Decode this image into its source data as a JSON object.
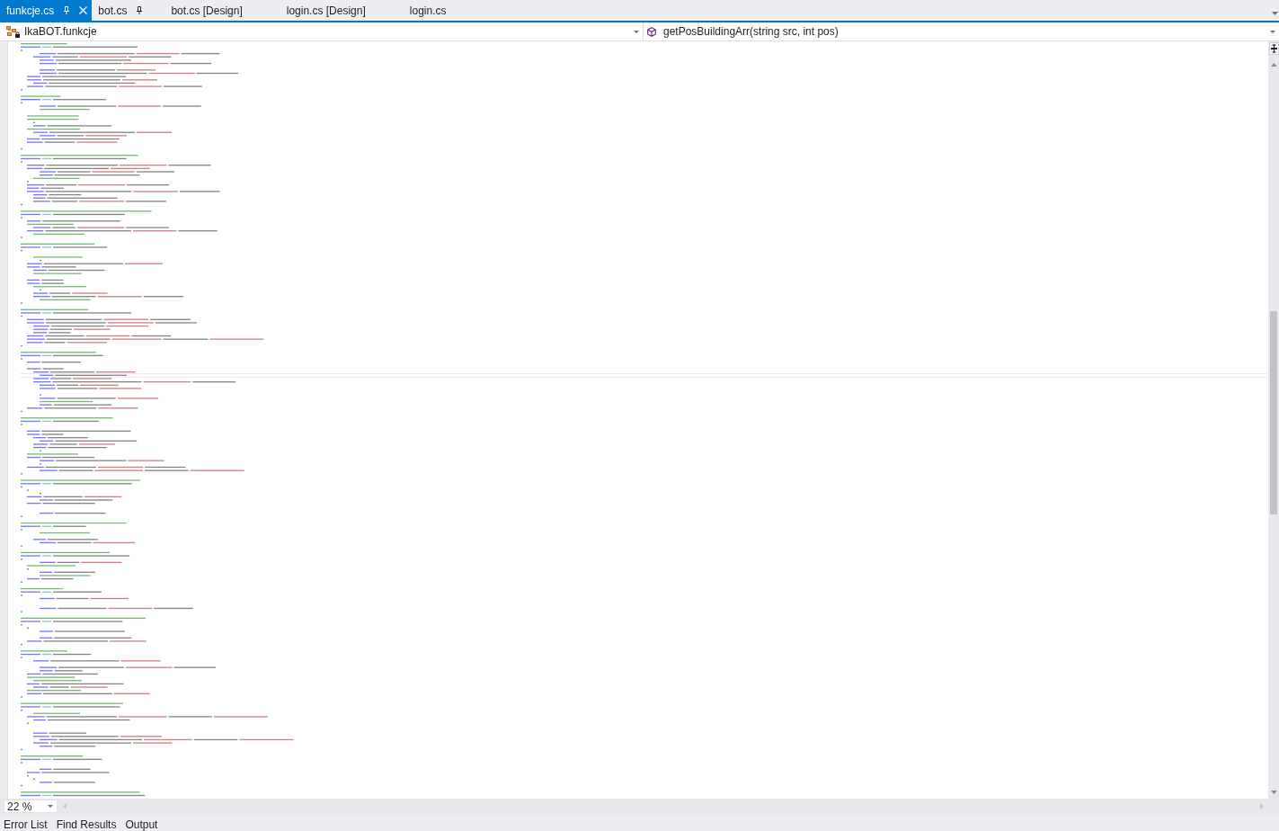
{
  "document_tabs": [
    {
      "label": "funkcje.cs",
      "selected": true,
      "pinned": true
    },
    {
      "label": "bot.cs",
      "selected": false,
      "pinned": true
    },
    {
      "label": "bot.cs [Design]",
      "selected": false,
      "pinned": false
    },
    {
      "label": "login.cs [Design]",
      "selected": false,
      "pinned": false
    },
    {
      "label": "login.cs",
      "selected": false,
      "pinned": false
    }
  ],
  "navigation_bar": {
    "type_dropdown": {
      "value": "IkaBOT.funkcje"
    },
    "member_dropdown": {
      "value": "getPosBuildingArr(string src, int pos)"
    }
  },
  "editor": {
    "zoom_dropdown": {
      "value": "22 %"
    }
  },
  "tool_window_tabs": [
    {
      "label": "Error List",
      "selected": false
    },
    {
      "label": "Find Results",
      "selected": false
    },
    {
      "label": "Output",
      "selected": false
    }
  ]
}
